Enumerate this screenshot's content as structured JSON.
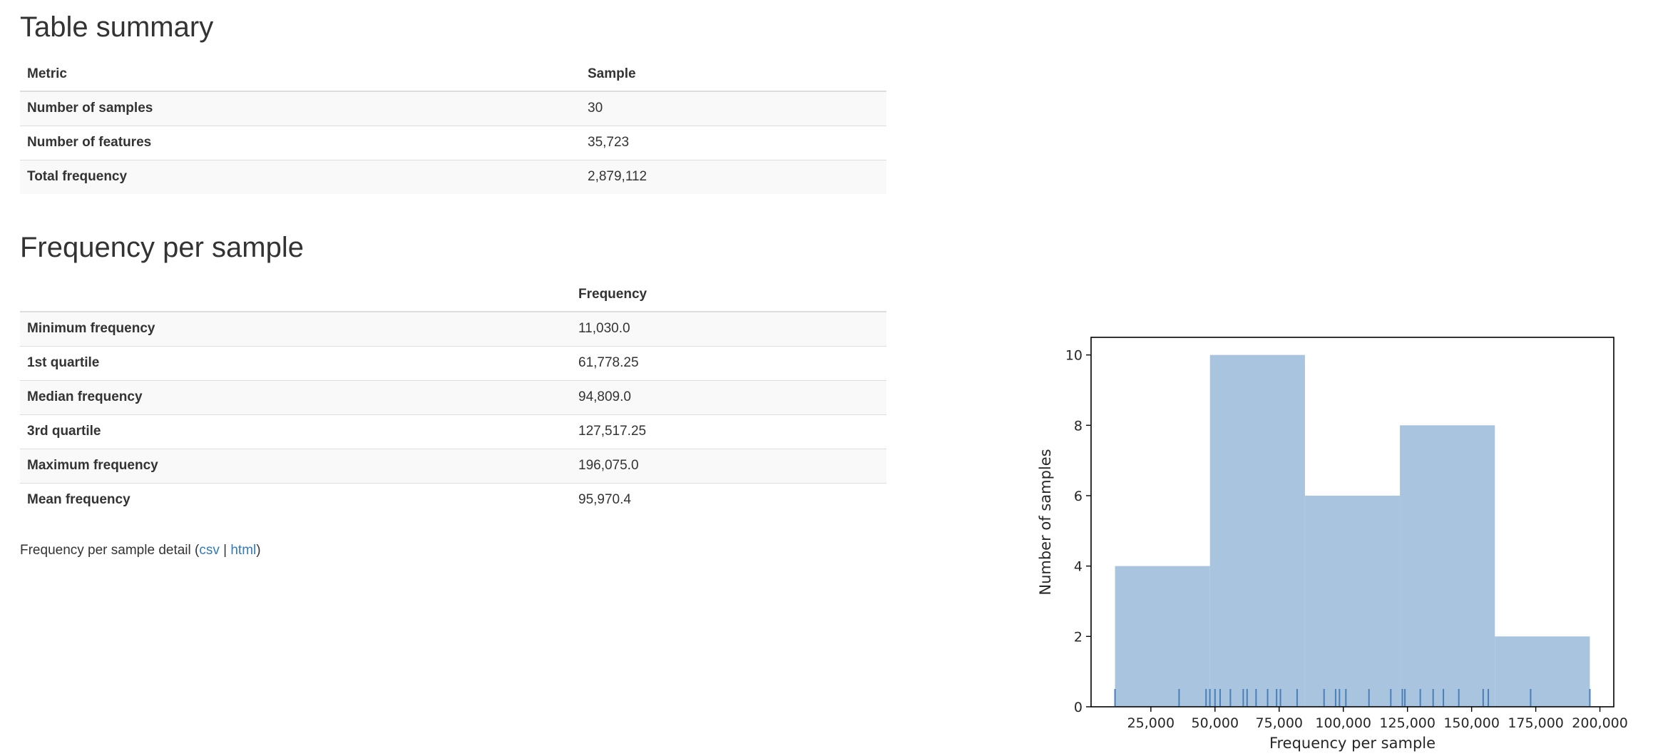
{
  "table_summary": {
    "title": "Table summary",
    "columns": [
      "Metric",
      "Sample"
    ],
    "rows": [
      {
        "metric": "Number of samples",
        "value": "30"
      },
      {
        "metric": "Number of features",
        "value": "35,723"
      },
      {
        "metric": "Total frequency",
        "value": "2,879,112"
      }
    ]
  },
  "frequency_per_sample": {
    "title": "Frequency per sample",
    "columns": [
      "",
      "Frequency"
    ],
    "rows": [
      {
        "metric": "Minimum frequency",
        "value": "11,030.0"
      },
      {
        "metric": "1st quartile",
        "value": "61,778.25"
      },
      {
        "metric": "Median frequency",
        "value": "94,809.0"
      },
      {
        "metric": "3rd quartile",
        "value": "127,517.25"
      },
      {
        "metric": "Maximum frequency",
        "value": "196,075.0"
      },
      {
        "metric": "Mean frequency",
        "value": "95,970.4"
      }
    ]
  },
  "detail": {
    "prefix": "Frequency per sample detail (",
    "csv_label": "csv",
    "separator": " | ",
    "html_label": "html",
    "suffix": ")"
  },
  "chart_data": {
    "type": "bar",
    "xlabel": "Frequency per sample",
    "ylabel": "Number of samples",
    "xlim": [
      1700,
      205400
    ],
    "ylim": [
      0,
      10.5
    ],
    "bins": [
      {
        "x0": 11030,
        "x1": 48038,
        "count": 4
      },
      {
        "x0": 48038,
        "x1": 85047,
        "count": 10
      },
      {
        "x0": 85047,
        "x1": 122056,
        "count": 6
      },
      {
        "x0": 122056,
        "x1": 159066,
        "count": 8
      },
      {
        "x0": 159066,
        "x1": 196075,
        "count": 2
      }
    ],
    "rug": [
      11030,
      36000,
      46500,
      48000,
      50000,
      52000,
      56000,
      61000,
      62500,
      66000,
      70500,
      74000,
      75500,
      82000,
      92500,
      97000,
      98500,
      101000,
      110000,
      118500,
      123000,
      124000,
      130000,
      135000,
      139000,
      145000,
      154500,
      156500,
      173000,
      196075
    ],
    "x_ticks": [
      25000,
      50000,
      75000,
      100000,
      125000,
      150000,
      175000,
      200000
    ],
    "x_tick_labels": [
      "25,000",
      "50,000",
      "75,000",
      "100,000",
      "125,000",
      "150,000",
      "175,000",
      "200,000"
    ],
    "y_ticks": [
      0,
      2,
      4,
      6,
      8,
      10
    ],
    "y_tick_labels": [
      "0",
      "2",
      "4",
      "6",
      "8",
      "10"
    ],
    "bar_color": "#a8c4de",
    "rug_color": "#4a7fb8",
    "grid": false
  }
}
